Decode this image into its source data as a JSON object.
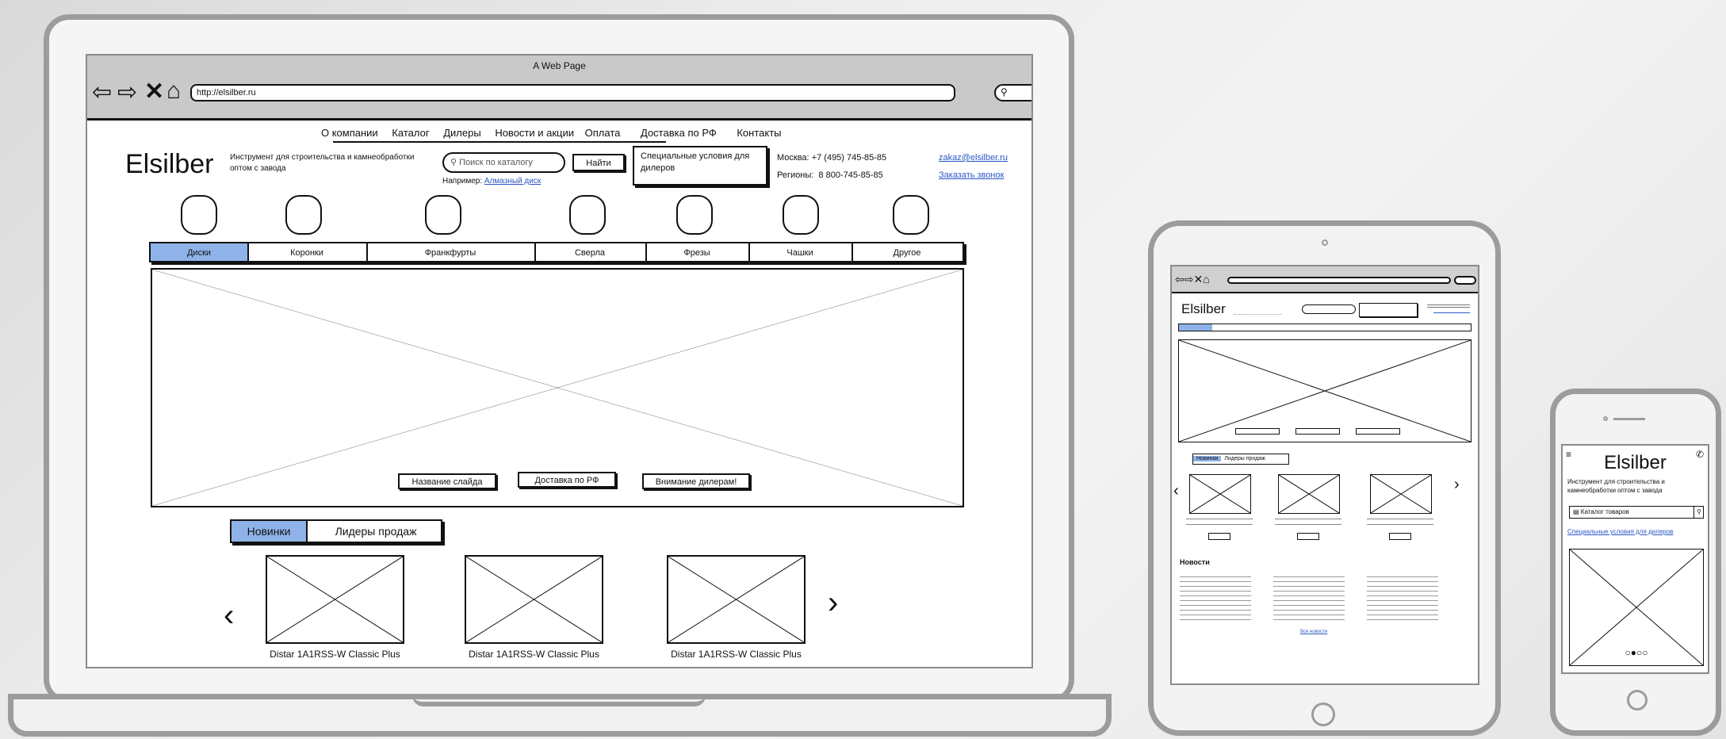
{
  "laptop": {
    "window_title": "A Web Page",
    "url": "http://elsilber.ru",
    "top_menu": [
      "О компании",
      "Каталог",
      "Дилеры",
      "Новости и акции",
      "Оплата",
      "Доставка по РФ",
      "Контакты"
    ],
    "logo": "Elsilber",
    "tagline": "Инструмент для строительства и камнеобработки оптом с завода",
    "search_placeholder": "Поиск по каталогу",
    "search_button": "Найти",
    "example_prefix": "Например:",
    "example_link": "Алмазный диск",
    "dealer_box": "Специальные условия для дилеров",
    "phone_moscow_label": "Москва:",
    "phone_moscow": "+7 (495) 745-85-85",
    "phone_regions_label": "Регионы:",
    "phone_regions": "8 800-745-85-85",
    "email": "zakaz@elsilber.ru",
    "callback": "Заказать звонок",
    "category_tabs": [
      "Диски",
      "Коронки",
      "Франкфурты",
      "Сверла",
      "Фрезы",
      "Чашки",
      "Другое"
    ],
    "slide_buttons": [
      "Название слайда",
      "Доставка по РФ",
      "Внимание дилерам!"
    ],
    "product_tabs": [
      "Новинки",
      "Лидеры продаж"
    ],
    "products": [
      "Distar 1A1RSS-W Classic Plus",
      "Distar 1A1RSS-W Classic Plus",
      "Distar 1A1RSS-W Classic Plus"
    ],
    "arrow_left": "‹",
    "arrow_right": "›"
  },
  "tablet": {
    "logo": "Elsilber",
    "tab_new": "Новинки",
    "tab_leaders": "Лидеры продаж",
    "news_title": "Новости",
    "all_news": "Все новости",
    "arrow_left": "‹",
    "arrow_right": "›"
  },
  "phone": {
    "logo": "Elsilber",
    "tagline": "Инструмент для строительства и камнеобработки оптом с завода",
    "catalog": "Каталог товаров",
    "dealer_link": "Специальные условия для дилеров"
  },
  "colors": {
    "accent_blue": "#8fb3e8",
    "link_blue": "#2a56c6",
    "frame_gray": "#9c9c9c"
  }
}
